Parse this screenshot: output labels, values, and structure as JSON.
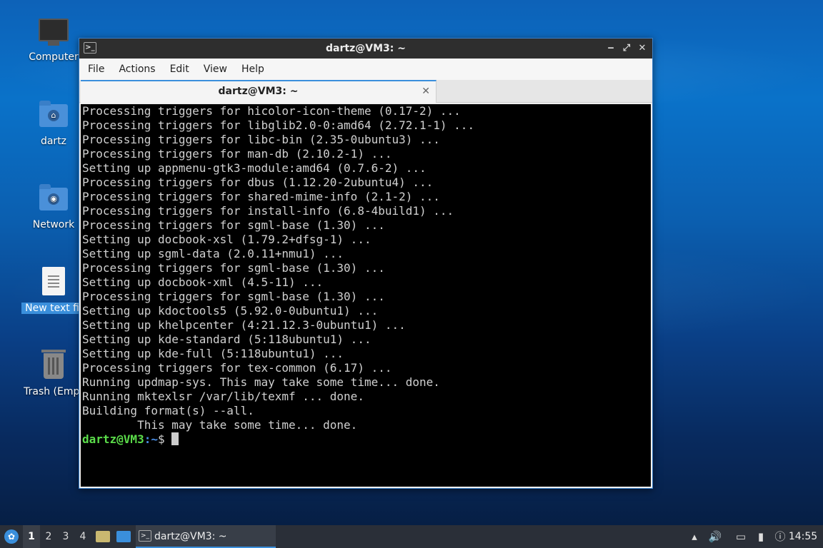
{
  "desktop": {
    "icons": [
      {
        "label": "Computer"
      },
      {
        "label": "dartz"
      },
      {
        "label": "Network"
      },
      {
        "label": "New text fil"
      },
      {
        "label": "Trash (Empt"
      }
    ]
  },
  "window": {
    "title": "dartz@VM3: ~",
    "controls": {
      "minimize": "‒",
      "maximize": "⤢",
      "close": "✕"
    },
    "menu": [
      "File",
      "Actions",
      "Edit",
      "View",
      "Help"
    ],
    "tab": {
      "label": "dartz@VM3: ~",
      "close": "✕"
    }
  },
  "terminal": {
    "lines": [
      "Processing triggers for hicolor-icon-theme (0.17-2) ...",
      "Processing triggers for libglib2.0-0:amd64 (2.72.1-1) ...",
      "Processing triggers for libc-bin (2.35-0ubuntu3) ...",
      "Processing triggers for man-db (2.10.2-1) ...",
      "Setting up appmenu-gtk3-module:amd64 (0.7.6-2) ...",
      "Processing triggers for dbus (1.12.20-2ubuntu4) ...",
      "Processing triggers for shared-mime-info (2.1-2) ...",
      "Processing triggers for install-info (6.8-4build1) ...",
      "Processing triggers for sgml-base (1.30) ...",
      "Setting up docbook-xsl (1.79.2+dfsg-1) ...",
      "Setting up sgml-data (2.0.11+nmu1) ...",
      "Processing triggers for sgml-base (1.30) ...",
      "Setting up docbook-xml (4.5-11) ...",
      "Processing triggers for sgml-base (1.30) ...",
      "Setting up kdoctools5 (5.92.0-0ubuntu1) ...",
      "Setting up khelpcenter (4:21.12.3-0ubuntu1) ...",
      "Setting up kde-standard (5:118ubuntu1) ...",
      "Setting up kde-full (5:118ubuntu1) ...",
      "Processing triggers for tex-common (6.17) ...",
      "Running updmap-sys. This may take some time... done.",
      "Running mktexlsr /var/lib/texmf ... done.",
      "Building format(s) --all.",
      "        This may take some time... done."
    ],
    "prompt": {
      "user": "dartz@VM3",
      "sep": ":",
      "path": "~",
      "symbol": "$ "
    }
  },
  "taskbar": {
    "workspaces": [
      "1",
      "2",
      "3",
      "4"
    ],
    "task_label": "dartz@VM3: ~",
    "clock": "14:55"
  },
  "colors": {
    "prompt_user": "#5bdc4a",
    "prompt_path": "#4a8fe8",
    "accent": "#3a8fdc"
  }
}
